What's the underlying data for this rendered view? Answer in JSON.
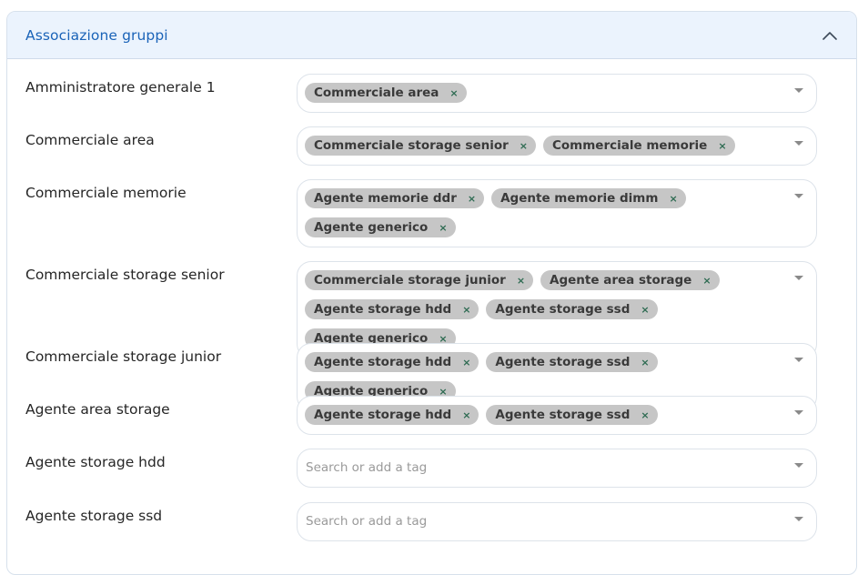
{
  "panel": {
    "title": "Associazione gruppi",
    "collapse_icon": "chevron-up-icon",
    "accent_color": "#1a63b8"
  },
  "rows": [
    {
      "label": "Amministratore generale 1",
      "tags": [
        "Commerciale area"
      ],
      "placeholder": ""
    },
    {
      "label": "Commerciale area",
      "tags": [
        "Commerciale storage senior",
        "Commerciale memorie"
      ],
      "placeholder": ""
    },
    {
      "label": "Commerciale memorie",
      "tags": [
        "Agente memorie ddr",
        "Agente memorie dimm",
        "Agente generico"
      ],
      "placeholder": ""
    },
    {
      "label": "Commerciale storage senior",
      "tags": [
        "Commerciale storage junior",
        "Agente area storage",
        "Agente storage hdd",
        "Agente storage ssd",
        "Agente generico"
      ],
      "placeholder": ""
    },
    {
      "label": "Commerciale storage junior",
      "tags": [
        "Agente storage hdd",
        "Agente storage ssd",
        "Agente generico"
      ],
      "placeholder": ""
    },
    {
      "label": "Agente area storage",
      "tags": [
        "Agente storage hdd",
        "Agente storage ssd"
      ],
      "placeholder": ""
    },
    {
      "label": "Agente storage hdd",
      "tags": [],
      "placeholder": "Search or add a tag"
    },
    {
      "label": "Agente storage ssd",
      "tags": [],
      "placeholder": "Search or add a tag"
    }
  ],
  "icons": {
    "tag_remove": "×",
    "dropdown": "caret-down-icon"
  }
}
